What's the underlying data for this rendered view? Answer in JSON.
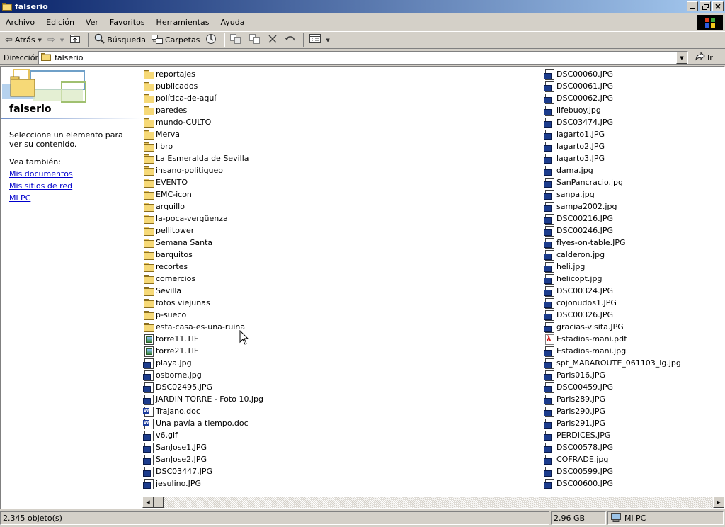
{
  "window": {
    "title": "falserio"
  },
  "menu": [
    "Archivo",
    "Edición",
    "Ver",
    "Favoritos",
    "Herramientas",
    "Ayuda"
  ],
  "toolbar": {
    "back": "Atrás",
    "search": "Búsqueda",
    "folders": "Carpetas"
  },
  "address": {
    "label": "Dirección",
    "value": "falserio",
    "go": "Ir"
  },
  "panel": {
    "title": "falserio",
    "description": "Seleccione un elemento para ver su contenido.",
    "see_also": "Vea también:",
    "links": [
      "Mis documentos",
      "Mis sitios de red",
      "Mi PC"
    ]
  },
  "files_col1": [
    {
      "name": "reportajes",
      "type": "folder"
    },
    {
      "name": "publicados",
      "type": "folder"
    },
    {
      "name": "política-de-aquí",
      "type": "folder"
    },
    {
      "name": "paredes",
      "type": "folder"
    },
    {
      "name": "mundo-CULTO",
      "type": "folder"
    },
    {
      "name": "Merva",
      "type": "folder"
    },
    {
      "name": "libro",
      "type": "folder"
    },
    {
      "name": "La Esmeralda de Sevilla",
      "type": "folder"
    },
    {
      "name": "insano-politiqueo",
      "type": "folder"
    },
    {
      "name": "EVENTO",
      "type": "folder"
    },
    {
      "name": "EMC-icon",
      "type": "folder"
    },
    {
      "name": "arquillo",
      "type": "folder"
    },
    {
      "name": "la-poca-vergüenza",
      "type": "folder"
    },
    {
      "name": "pellitower",
      "type": "folder"
    },
    {
      "name": "Semana Santa",
      "type": "folder"
    },
    {
      "name": "barquitos",
      "type": "folder"
    },
    {
      "name": "recortes",
      "type": "folder"
    },
    {
      "name": "comercios",
      "type": "folder"
    },
    {
      "name": "Sevilla",
      "type": "folder"
    },
    {
      "name": "fotos viejunas",
      "type": "folder"
    },
    {
      "name": "p-sueco",
      "type": "folder"
    },
    {
      "name": "esta-casa-es-una-ruina",
      "type": "folder"
    },
    {
      "name": "torre11.TIF",
      "type": "tif"
    },
    {
      "name": "torre21.TIF",
      "type": "tif"
    },
    {
      "name": "playa.jpg",
      "type": "img"
    },
    {
      "name": "osborne.jpg",
      "type": "img"
    },
    {
      "name": "DSC02495.JPG",
      "type": "img"
    },
    {
      "name": "JARDIN TORRE - Foto 10.jpg",
      "type": "img"
    },
    {
      "name": "Trajano.doc",
      "type": "doc"
    },
    {
      "name": "Una pavía a tiempo.doc",
      "type": "doc"
    },
    {
      "name": "v6.gif",
      "type": "img"
    },
    {
      "name": "SanJose1.JPG",
      "type": "img"
    },
    {
      "name": "SanJose2.JPG",
      "type": "img"
    },
    {
      "name": "DSC03447.JPG",
      "type": "img"
    },
    {
      "name": "jesulino.JPG",
      "type": "img"
    }
  ],
  "files_col2": [
    {
      "name": "DSC00060.JPG",
      "type": "img"
    },
    {
      "name": "DSC00061.JPG",
      "type": "img"
    },
    {
      "name": "DSC00062.JPG",
      "type": "img"
    },
    {
      "name": "lifebuoy.jpg",
      "type": "img"
    },
    {
      "name": "DSC03474.JPG",
      "type": "img"
    },
    {
      "name": "lagarto1.JPG",
      "type": "img"
    },
    {
      "name": "lagarto2.JPG",
      "type": "img"
    },
    {
      "name": "lagarto3.JPG",
      "type": "img"
    },
    {
      "name": "dama.jpg",
      "type": "img"
    },
    {
      "name": "SanPancracio.jpg",
      "type": "img"
    },
    {
      "name": "sanpa.jpg",
      "type": "img"
    },
    {
      "name": "sampa2002.jpg",
      "type": "img"
    },
    {
      "name": "DSC00216.JPG",
      "type": "img"
    },
    {
      "name": "DSC00246.JPG",
      "type": "img"
    },
    {
      "name": "flyes-on-table.JPG",
      "type": "img"
    },
    {
      "name": "calderon.jpg",
      "type": "img"
    },
    {
      "name": "heli.jpg",
      "type": "img"
    },
    {
      "name": "helicopt.jpg",
      "type": "img"
    },
    {
      "name": "DSC00324.JPG",
      "type": "img"
    },
    {
      "name": "cojonudos1.JPG",
      "type": "img"
    },
    {
      "name": "DSC00326.JPG",
      "type": "img"
    },
    {
      "name": "gracias-visita.JPG",
      "type": "img"
    },
    {
      "name": "Estadios-mani.pdf",
      "type": "pdf"
    },
    {
      "name": "Estadios-mani.jpg",
      "type": "img"
    },
    {
      "name": "spt_MARAROUTE_061103_lg.jpg",
      "type": "img"
    },
    {
      "name": "Paris016.JPG",
      "type": "img"
    },
    {
      "name": "DSC00459.JPG",
      "type": "img"
    },
    {
      "name": "Paris289.JPG",
      "type": "img"
    },
    {
      "name": "Paris290.JPG",
      "type": "img"
    },
    {
      "name": "Paris291.JPG",
      "type": "img"
    },
    {
      "name": "PERDICES.JPG",
      "type": "img"
    },
    {
      "name": "DSC00578.JPG",
      "type": "img"
    },
    {
      "name": "COFRADE.jpg",
      "type": "img"
    },
    {
      "name": "DSC00599.JPG",
      "type": "img"
    },
    {
      "name": "DSC00600.JPG",
      "type": "img"
    }
  ],
  "status": {
    "count": "2.345 objeto(s)",
    "size": "2,96 GB",
    "location": "Mi PC"
  }
}
